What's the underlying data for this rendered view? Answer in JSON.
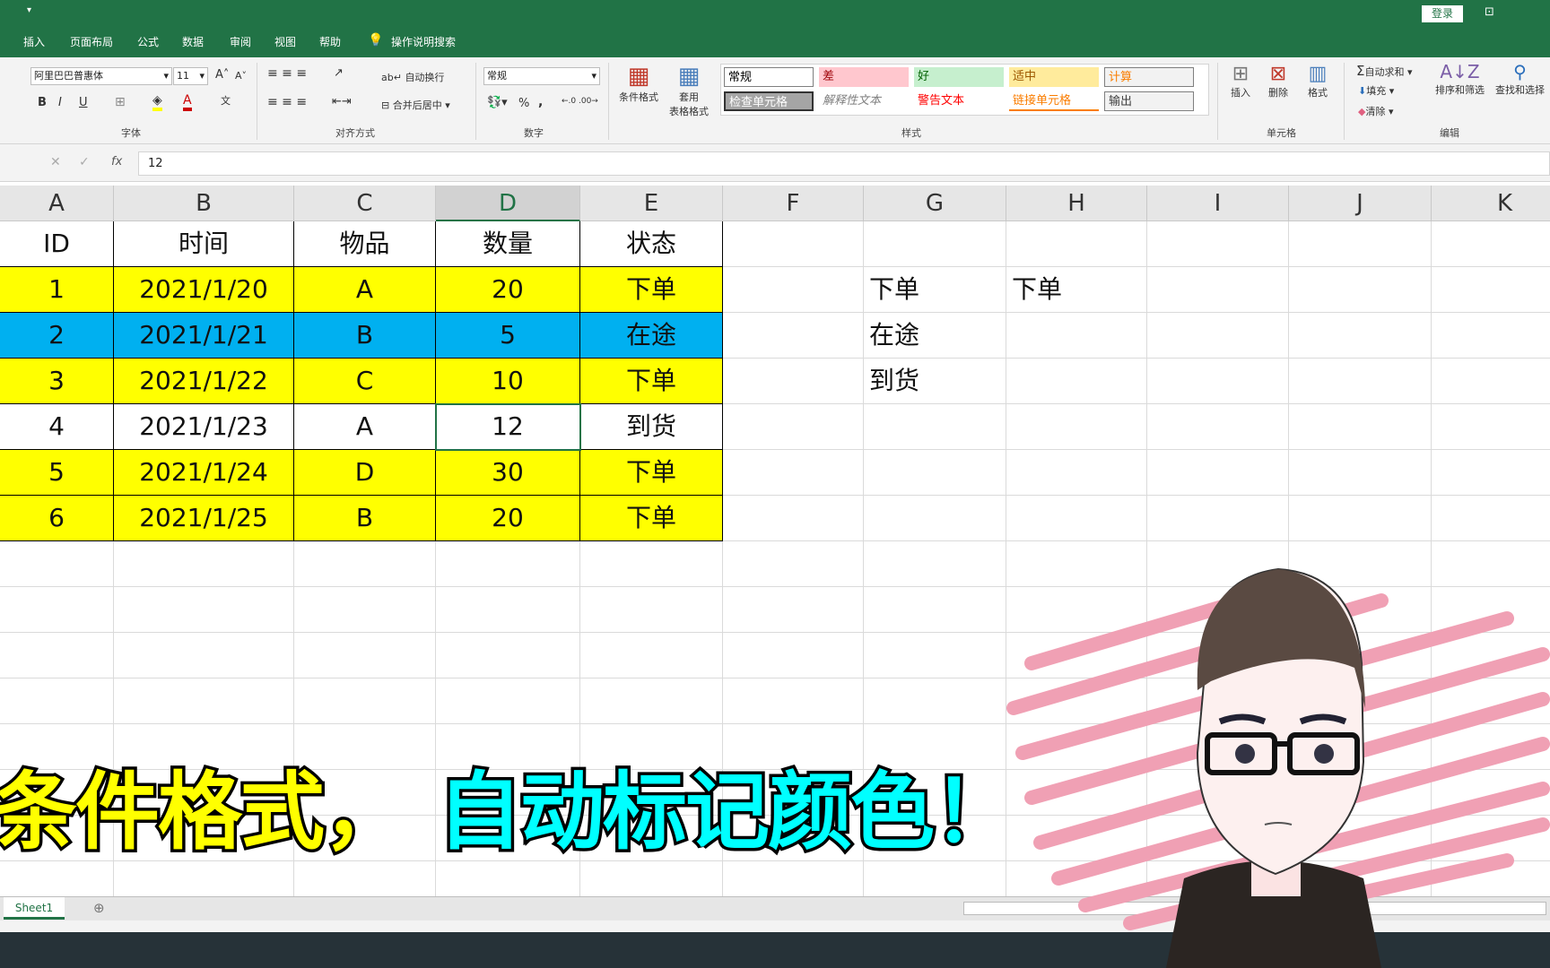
{
  "titlebar": {
    "login": "登录",
    "tabs": [
      "插入",
      "页面布局",
      "公式",
      "数据",
      "审阅",
      "视图",
      "帮助"
    ],
    "search": "操作说明搜索"
  },
  "ribbon": {
    "font": {
      "name": "阿里巴巴普惠体",
      "size": "11",
      "group": "字体",
      "bold": "B",
      "italic": "I",
      "underline": "U"
    },
    "align": {
      "wrap": "自动换行",
      "merge": "合并后居中",
      "group": "对齐方式"
    },
    "number": {
      "format": "常规",
      "group": "数字",
      "percent": "%",
      "comma": ","
    },
    "styles": {
      "cond": "条件格式",
      "table1": "套用",
      "table2": "表格格式",
      "group": "样式",
      "cells": [
        {
          "label": "常规",
          "bg": "#ffffff",
          "fg": "#000000"
        },
        {
          "label": "差",
          "bg": "#ffc7ce",
          "fg": "#9c0006"
        },
        {
          "label": "好",
          "bg": "#c6efce",
          "fg": "#006100"
        },
        {
          "label": "适中",
          "bg": "#ffeb9c",
          "fg": "#9c5700"
        },
        {
          "label": "计算",
          "bg": "#f2f2f2",
          "fg": "#fa7d00"
        },
        {
          "label": "检查单元格",
          "bg": "#a5a5a5",
          "fg": "#ffffff"
        },
        {
          "label": "解释性文本",
          "bg": "#ffffff",
          "fg": "#7f7f7f"
        },
        {
          "label": "警告文本",
          "bg": "#ffffff",
          "fg": "#ff0000"
        },
        {
          "label": "链接单元格",
          "bg": "#ffffff",
          "fg": "#fa7d00"
        },
        {
          "label": "输出",
          "bg": "#f2f2f2",
          "fg": "#3f3f3f"
        }
      ]
    },
    "cells": {
      "insert": "插入",
      "delete": "删除",
      "format": "格式",
      "group": "单元格"
    },
    "edit": {
      "autosum": "自动求和",
      "fill": "填充",
      "clear": "清除",
      "sort": "排序和筛选",
      "find": "查找和选择",
      "group": "编辑"
    }
  },
  "formula": {
    "value": "12",
    "fx": "fx"
  },
  "sheet": {
    "columns": [
      "A",
      "B",
      "C",
      "D",
      "E",
      "F",
      "G",
      "H",
      "I",
      "J",
      "K"
    ],
    "selected_column": "D",
    "header": [
      "ID",
      "时间",
      "物品",
      "数量",
      "状态"
    ],
    "rows": [
      {
        "cells": [
          "1",
          "2021/1/20",
          "A",
          "20",
          "下单"
        ],
        "fill": "#ffff00"
      },
      {
        "cells": [
          "2",
          "2021/1/21",
          "B",
          "5",
          "在途"
        ],
        "fill": "#00b0f0"
      },
      {
        "cells": [
          "3",
          "2021/1/22",
          "C",
          "10",
          "下单"
        ],
        "fill": "#ffff00"
      },
      {
        "cells": [
          "4",
          "2021/1/23",
          "A",
          "12",
          "到货"
        ],
        "fill": "#ffffff"
      },
      {
        "cells": [
          "5",
          "2021/1/24",
          "D",
          "30",
          "下单"
        ],
        "fill": "#ffff00"
      },
      {
        "cells": [
          "6",
          "2021/1/25",
          "B",
          "20",
          "下单"
        ],
        "fill": "#ffff00"
      }
    ],
    "side": {
      "G": [
        "下单",
        "在途",
        "到货"
      ],
      "H": [
        "下单"
      ]
    },
    "active_cell": "D5",
    "tab": "Sheet1"
  },
  "overlay": {
    "part1": "条件格式，",
    "part2": "自动标记颜色！",
    "color1": "#ffff00",
    "color2": "#00ffff"
  }
}
